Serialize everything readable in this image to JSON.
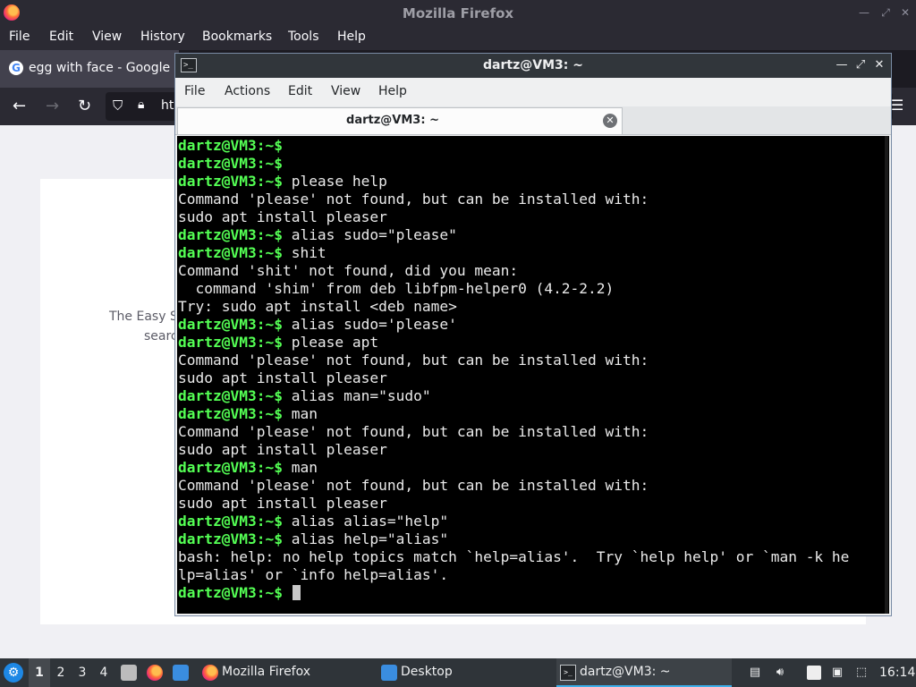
{
  "firefox": {
    "window_title": "Mozilla Firefox",
    "menu": [
      "File",
      "Edit",
      "View",
      "History",
      "Bookmarks",
      "Tools",
      "Help"
    ],
    "tab_title": "egg with face - Google S",
    "url_fragment": "ht",
    "snippet_line1": "The Easy S",
    "snippet_line2": "searc"
  },
  "terminal": {
    "window_title": "dartz@VM3: ~",
    "menu": [
      "File",
      "Actions",
      "Edit",
      "View",
      "Help"
    ],
    "tab_label": "dartz@VM3: ~",
    "prompt_user": "dartz@VM3",
    "prompt_sep": ":",
    "prompt_path": "~",
    "prompt_sym": "$",
    "lines": [
      {
        "p": true,
        "t": ""
      },
      {
        "p": true,
        "t": ""
      },
      {
        "p": true,
        "t": " please help"
      },
      {
        "p": false,
        "t": "Command 'please' not found, but can be installed with:"
      },
      {
        "p": false,
        "t": "sudo apt install pleaser"
      },
      {
        "p": true,
        "t": " alias sudo=\"please\""
      },
      {
        "p": true,
        "t": " shit"
      },
      {
        "p": false,
        "t": "Command 'shit' not found, did you mean:"
      },
      {
        "p": false,
        "t": "  command 'shim' from deb libfpm-helper0 (4.2-2.2)"
      },
      {
        "p": false,
        "t": "Try: sudo apt install <deb name>"
      },
      {
        "p": true,
        "t": " alias sudo='please'"
      },
      {
        "p": true,
        "t": " please apt"
      },
      {
        "p": false,
        "t": "Command 'please' not found, but can be installed with:"
      },
      {
        "p": false,
        "t": "sudo apt install pleaser"
      },
      {
        "p": true,
        "t": " alias man=\"sudo\""
      },
      {
        "p": true,
        "t": " man"
      },
      {
        "p": false,
        "t": "Command 'please' not found, but can be installed with:"
      },
      {
        "p": false,
        "t": "sudo apt install pleaser"
      },
      {
        "p": true,
        "t": " man"
      },
      {
        "p": false,
        "t": "Command 'please' not found, but can be installed with:"
      },
      {
        "p": false,
        "t": "sudo apt install pleaser"
      },
      {
        "p": true,
        "t": " alias alias=\"help\""
      },
      {
        "p": true,
        "t": " alias help=\"alias\""
      },
      {
        "p": false,
        "t": "bash: help: no help topics match `help=alias'.  Try `help help' or `man -k he"
      },
      {
        "p": false,
        "t": "lp=alias' or `info help=alias'."
      },
      {
        "p": true,
        "t": " ",
        "cursor": true
      }
    ]
  },
  "taskbar": {
    "workspaces": [
      "1",
      "2",
      "3",
      "4"
    ],
    "tasks": [
      {
        "label": "Mozilla Firefox"
      },
      {
        "label": "Desktop"
      },
      {
        "label": "dartz@VM3: ~"
      }
    ],
    "clock": "16:14"
  }
}
